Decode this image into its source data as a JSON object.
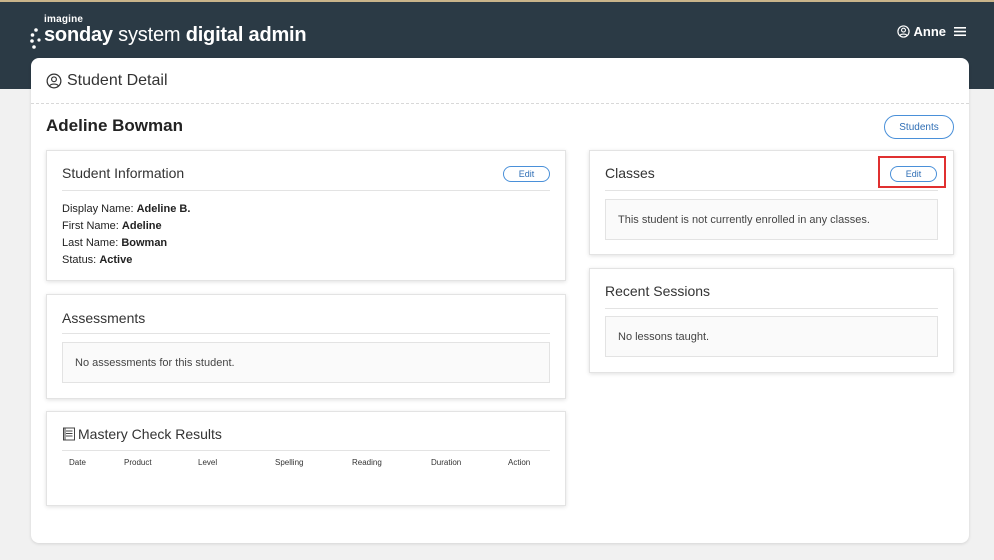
{
  "app": {
    "brand_small": "imagine",
    "brand_word1": "sonday",
    "brand_word2": " system ",
    "brand_word3": "digital admin",
    "user_name": "Anne",
    "icons": {
      "user": "user-circle-icon",
      "menu": "hamburger-menu-icon",
      "detail": "user-circle-icon",
      "mastery": "list-document-icon"
    }
  },
  "page": {
    "title": "Student Detail",
    "student_name": "Adeline Bowman",
    "students_button": "Students"
  },
  "student_info": {
    "title": "Student Information",
    "edit_label": "Edit",
    "display_name_label": "Display Name:",
    "display_name_value": "Adeline B.",
    "first_name_label": "First Name:",
    "first_name_value": "Adeline",
    "last_name_label": "Last Name:",
    "last_name_value": "Bowman",
    "status_label": "Status:",
    "status_value": "Active"
  },
  "assessments": {
    "title": "Assessments",
    "empty": "No assessments for this student."
  },
  "mastery": {
    "title": "Mastery Check Results",
    "columns": [
      "Date",
      "Product",
      "Level",
      "Spelling",
      "Reading",
      "Duration",
      "Action"
    ]
  },
  "classes": {
    "title": "Classes",
    "edit_label": "Edit",
    "empty": "This student is not currently enrolled in any classes."
  },
  "sessions": {
    "title": "Recent Sessions",
    "empty": "No lessons taught."
  },
  "colors": {
    "topbar": "#2b3a45",
    "accent": "#4a90d9",
    "highlight": "#e03030"
  }
}
